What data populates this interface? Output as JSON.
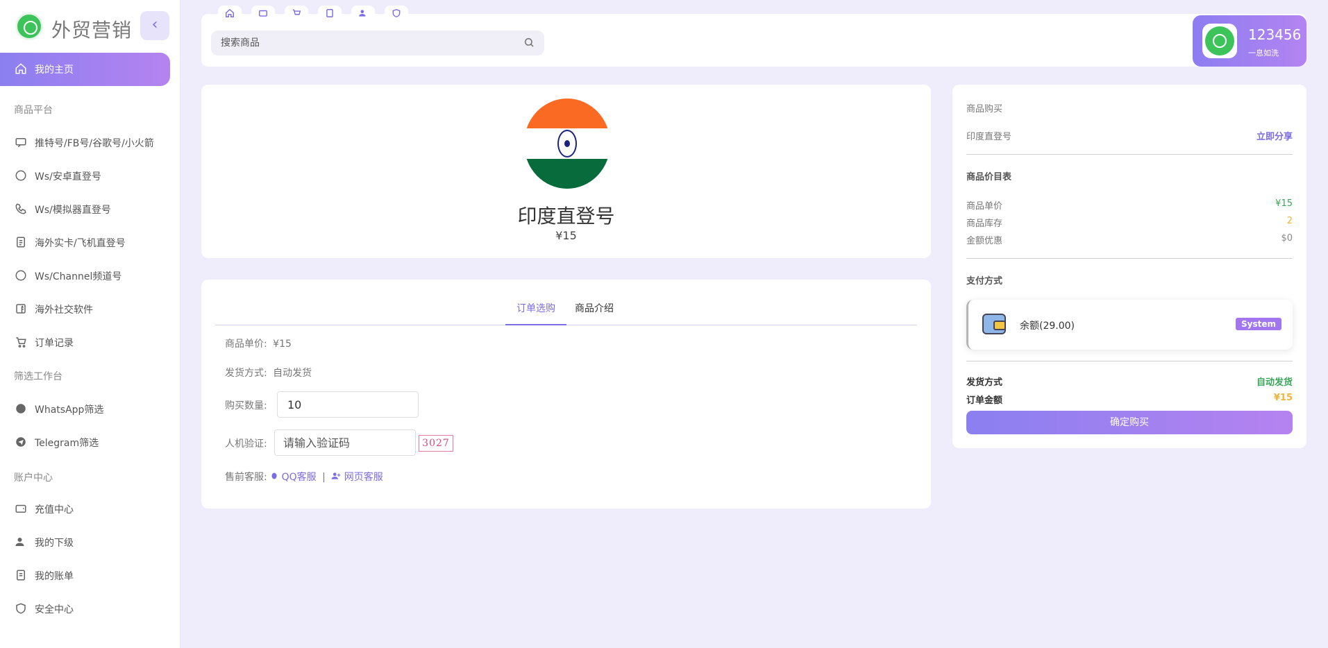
{
  "brand": {
    "title": "外贸营销"
  },
  "sidebar": {
    "home": "我的主页",
    "sections": {
      "products": "商品平台",
      "filter": "筛选工作台",
      "account": "账户中心"
    },
    "items": [
      {
        "label": "推特号/FB号/谷歌号/小火箭",
        "icon": "chat-icon"
      },
      {
        "label": "Ws/安卓直登号",
        "icon": "whatsapp-icon"
      },
      {
        "label": "Ws/模拟器直登号",
        "icon": "phone-icon"
      },
      {
        "label": "海外实卡/飞机直登号",
        "icon": "document-icon"
      },
      {
        "label": "Ws/Channel频道号",
        "icon": "whatsapp-icon"
      },
      {
        "label": "海外社交软件",
        "icon": "facebook-icon"
      },
      {
        "label": "订单记录",
        "icon": "cart-icon"
      },
      {
        "label": "WhatsApp筛选",
        "icon": "whatsapp-icon"
      },
      {
        "label": "Telegram筛选",
        "icon": "telegram-icon"
      },
      {
        "label": "充值中心",
        "icon": "wallet-icon"
      },
      {
        "label": "我的下级",
        "icon": "users-icon"
      },
      {
        "label": "我的账单",
        "icon": "bill-icon"
      },
      {
        "label": "安全中心",
        "icon": "shield-icon"
      }
    ]
  },
  "header": {
    "search_placeholder": "搜索商品",
    "user_name": "123456",
    "user_tag": "一息如洗"
  },
  "product": {
    "name": "印度直登号",
    "price": "¥15"
  },
  "order": {
    "tabs": [
      "订单选购",
      "商品介绍"
    ],
    "unit_price_label": "商品单价:",
    "unit_price_value": "¥15",
    "delivery_label": "发货方式:",
    "delivery_value": "自动发货",
    "qty_label": "购买数量:",
    "qty_value": "10",
    "captcha_label": "人机验证:",
    "captcha_placeholder": "请输入验证码",
    "captcha_code": "3027",
    "support_label": "售前客服:",
    "support_qq": "QQ客服",
    "support_sep": "|",
    "support_web": "网页客服"
  },
  "buy": {
    "section_title": "商品购买",
    "product_name": "印度直登号",
    "share": "立即分享",
    "price_table_title": "商品价目表",
    "unit_price_label": "商品单价",
    "unit_price_value": "¥15",
    "stock_label": "商品库存",
    "stock_value": "2",
    "discount_label": "金额优惠",
    "discount_value": "$0",
    "payment_title": "支付方式",
    "balance_label": "余额(29.00)",
    "balance_badge": "System",
    "delivery_label": "发货方式",
    "delivery_value": "自动发货",
    "total_label": "订单金额",
    "total_value": "¥15",
    "confirm": "确定购买"
  }
}
